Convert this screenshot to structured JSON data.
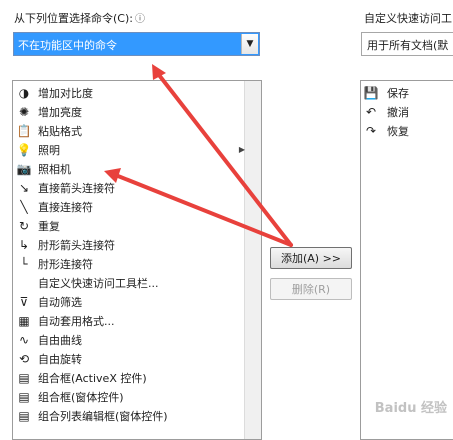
{
  "left_panel": {
    "label": "从下列位置选择命令(C):",
    "hint": "ⓘ",
    "selected": "不在功能区中的命令"
  },
  "right_panel": {
    "label": "自定义快速访问工",
    "selected": "用于所有文档(默"
  },
  "commands": [
    {
      "label": "增加对比度",
      "icon": "contrast-icon",
      "glyph": "◑",
      "has_submenu": false
    },
    {
      "label": "增加亮度",
      "icon": "brightness-icon",
      "glyph": "✺",
      "has_submenu": false
    },
    {
      "label": "粘贴格式",
      "icon": "paste-format-icon",
      "glyph": "📋",
      "has_submenu": false
    },
    {
      "label": "照明",
      "icon": "lighting-icon",
      "glyph": "💡",
      "has_submenu": true
    },
    {
      "label": "照相机",
      "icon": "camera-icon",
      "glyph": "📷",
      "has_submenu": false
    },
    {
      "label": "直接箭头连接符",
      "icon": "arrow-connector-icon",
      "glyph": "↘",
      "has_submenu": false
    },
    {
      "label": "直接连接符",
      "icon": "straight-connector-icon",
      "glyph": "╲",
      "has_submenu": false
    },
    {
      "label": "重复",
      "icon": "repeat-icon",
      "glyph": "↻",
      "has_submenu": false
    },
    {
      "label": "肘形箭头连接符",
      "icon": "elbow-arrow-connector-icon",
      "glyph": "↳",
      "has_submenu": false
    },
    {
      "label": "肘形连接符",
      "icon": "elbow-connector-icon",
      "glyph": "└",
      "has_submenu": false
    },
    {
      "label": "自定义快速访问工具栏...",
      "icon": "",
      "glyph": "",
      "has_submenu": false
    },
    {
      "label": "自动筛选",
      "icon": "autofilter-icon",
      "glyph": "⊽",
      "has_submenu": false
    },
    {
      "label": "自动套用格式...",
      "icon": "autoformat-icon",
      "glyph": "▦",
      "has_submenu": false
    },
    {
      "label": "自由曲线",
      "icon": "freeform-icon",
      "glyph": "∿",
      "has_submenu": false
    },
    {
      "label": "自由旋转",
      "icon": "free-rotate-icon",
      "glyph": "⟲",
      "has_submenu": false
    },
    {
      "label": "组合框(ActiveX 控件)",
      "icon": "combo-activex-icon",
      "glyph": "▤",
      "has_submenu": false
    },
    {
      "label": "组合框(窗体控件)",
      "icon": "combo-form-icon",
      "glyph": "▤",
      "has_submenu": false
    },
    {
      "label": "组合列表编辑框(窗体控件)",
      "icon": "combo-list-edit-icon",
      "glyph": "▤",
      "has_submenu": false
    }
  ],
  "buttons": {
    "add": "添加(A) >>",
    "remove": "删除(R)"
  },
  "qat_items": [
    {
      "label": "保存",
      "icon": "save-icon",
      "glyph": "💾"
    },
    {
      "label": "撤消",
      "icon": "undo-icon",
      "glyph": "↶"
    },
    {
      "label": "恢复",
      "icon": "redo-icon",
      "glyph": "↷"
    }
  ],
  "colors": {
    "selection": "#3399ff",
    "arrow": "#e8413c"
  },
  "watermark": "Baidu 经验"
}
